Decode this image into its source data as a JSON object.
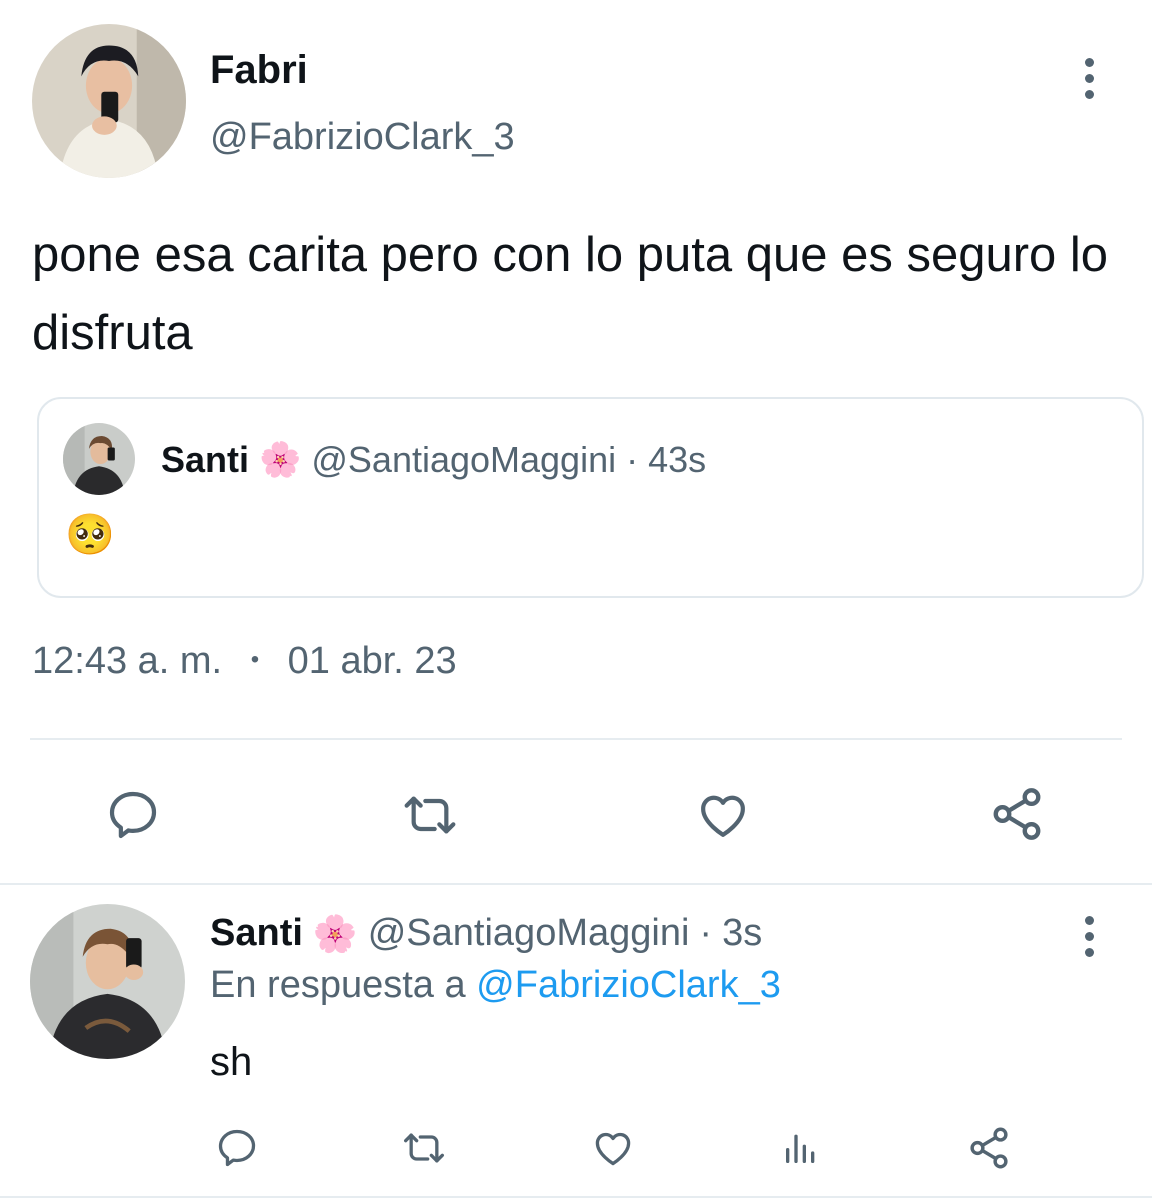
{
  "main_tweet": {
    "display_name": "Fabri",
    "handle": "@FabrizioClark_3",
    "text": "pone esa carita pero con lo puta que es seguro lo disfruta",
    "time": "12:43 a. m.",
    "separator": "•",
    "date": "01 abr. 23",
    "menu_icon": "more-vertical-icon"
  },
  "quoted_tweet": {
    "display_name": "Santi",
    "name_emoji": "🌸",
    "handle": "@SantiagoMaggini",
    "dot": "·",
    "time_ago": "43s",
    "text_emoji": "🥺"
  },
  "main_actions": [
    {
      "icon": "reply-icon"
    },
    {
      "icon": "retweet-icon"
    },
    {
      "icon": "like-icon"
    },
    {
      "icon": "share-icon"
    }
  ],
  "reply_tweet": {
    "display_name": "Santi",
    "name_emoji": "🌸",
    "handle": "@SantiagoMaggini",
    "dot": "·",
    "time_ago": "3s",
    "reply_prefix": "En respuesta a",
    "reply_to": "@FabrizioClark_3",
    "text": "sh",
    "menu_icon": "more-vertical-icon"
  },
  "reply_actions": [
    {
      "icon": "reply-icon"
    },
    {
      "icon": "retweet-icon"
    },
    {
      "icon": "like-icon"
    },
    {
      "icon": "analytics-icon"
    },
    {
      "icon": "share-icon"
    }
  ],
  "colors": {
    "text": "#0f1419",
    "muted": "#536471",
    "link": "#1d9bf0",
    "border": "#e1e8ed"
  }
}
